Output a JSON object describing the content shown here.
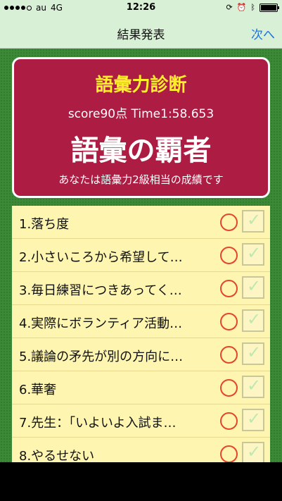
{
  "status_bar": {
    "carrier": "au",
    "network": "4G",
    "time": "12:26",
    "battery_level": 0.9,
    "signal_bars": 4
  },
  "nav": {
    "title": "結果発表",
    "next_label": "次へ"
  },
  "result": {
    "heading": "語彙力診断",
    "score": "score90点 Time1:58.653",
    "rank": "語彙の覇者",
    "description": "あなたは語彙力2級相当の成績です"
  },
  "questions": [
    {
      "label": "1.落ち度",
      "result": "correct",
      "checked": true
    },
    {
      "label": "2.小さいころから希望して…",
      "result": "correct",
      "checked": true
    },
    {
      "label": "3.毎日練習につきあってく…",
      "result": "correct",
      "checked": true
    },
    {
      "label": "4.実際にボランティア活動…",
      "result": "correct",
      "checked": true
    },
    {
      "label": "5.議論の矛先が別の方向に…",
      "result": "correct",
      "checked": true
    },
    {
      "label": "6.華奢",
      "result": "correct",
      "checked": true
    },
    {
      "label": "7.先生：「いよいよ入試ま…",
      "result": "correct",
      "checked": true
    },
    {
      "label": "8.やるせない",
      "result": "correct",
      "checked": true
    }
  ],
  "colors": {
    "nav_bg": "#d8f0d6",
    "content_bg": "#3c8a37",
    "card_bg": "#ac1c43",
    "heading_yellow": "#ffef2a",
    "list_bg": "#fdf5b0",
    "circle_red": "#e4452e",
    "link_blue": "#1a73e8"
  }
}
